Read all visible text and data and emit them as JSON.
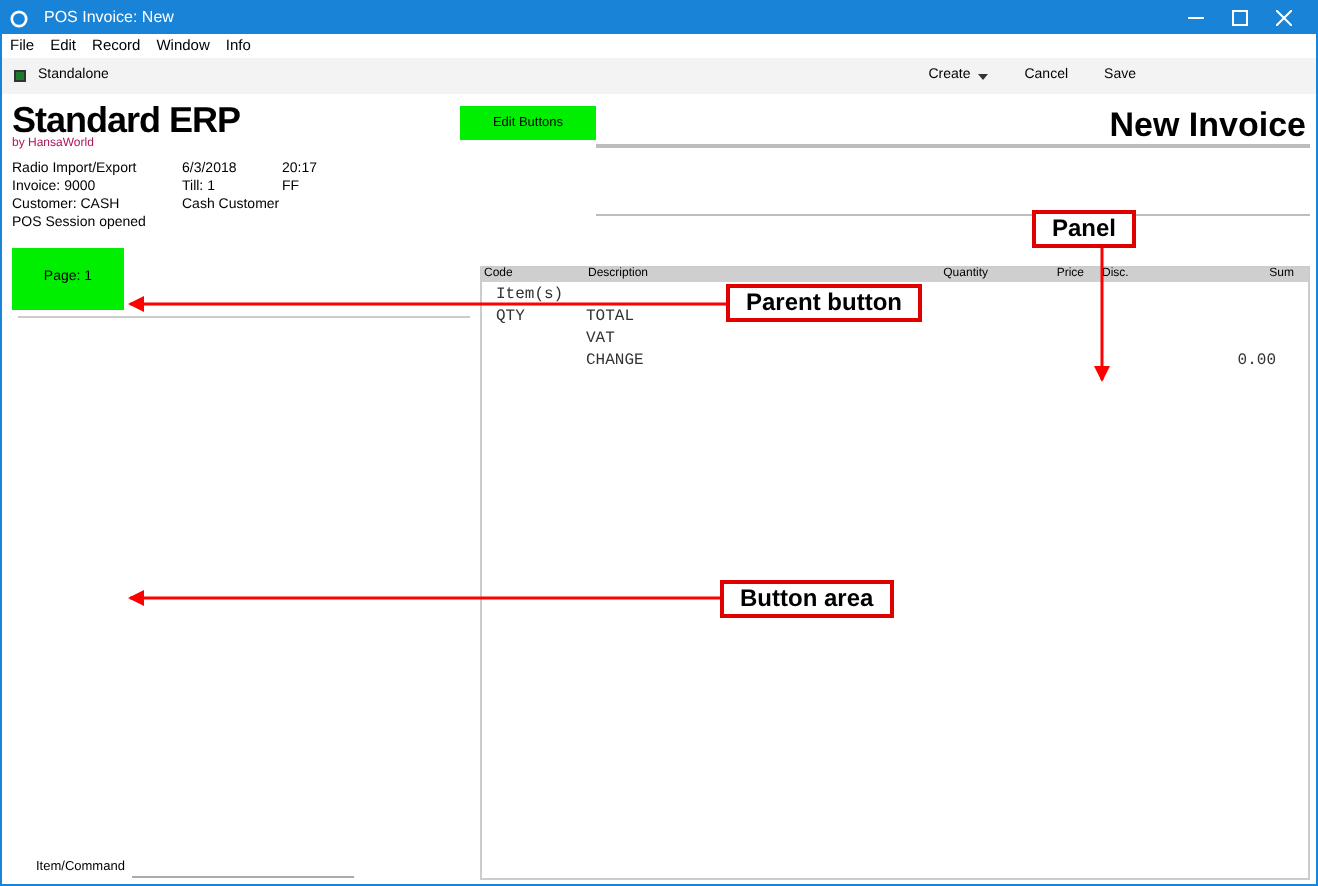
{
  "window": {
    "title": "POS Invoice: New"
  },
  "menu": [
    "File",
    "Edit",
    "Record",
    "Window",
    "Info"
  ],
  "toolbar": {
    "mode": "Standalone",
    "actions": [
      {
        "label": "Create",
        "kind": "dropdown"
      },
      {
        "label": "Cancel",
        "kind": "plain"
      },
      {
        "label": "Save",
        "kind": "plain"
      }
    ]
  },
  "logo": {
    "name": "Standard ERP",
    "byline": "by HansaWorld"
  },
  "edit_button": "Edit Buttons",
  "heading": "New Invoice",
  "info": [
    [
      "Radio Import/Export",
      "6/3/2018",
      "20:17"
    ],
    [
      "Invoice: 9000",
      "Till: 1",
      "FF"
    ],
    [
      "Customer: CASH",
      "Cash Customer"
    ],
    [
      "POS Session opened"
    ]
  ],
  "page_button": "Page: 1",
  "table": {
    "columns": [
      "Code",
      "Description",
      "Quantity",
      "Price",
      "Disc.",
      "Sum"
    ],
    "lines": [
      {
        "code": "Item(s)"
      },
      {
        "code": "QTY",
        "description": "TOTAL"
      },
      {
        "description": "VAT"
      },
      {
        "description": "CHANGE",
        "sum": "0.00"
      }
    ]
  },
  "command": {
    "label": "Item/Command"
  },
  "annotations": [
    {
      "label": "Panel"
    },
    {
      "label": "Parent button"
    },
    {
      "label": "Button area"
    }
  ]
}
